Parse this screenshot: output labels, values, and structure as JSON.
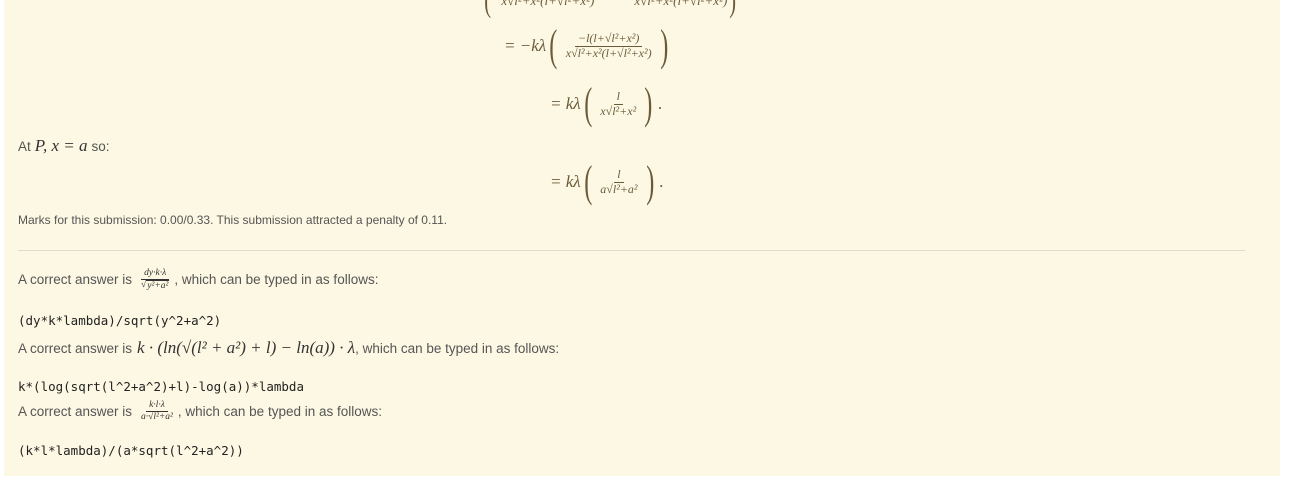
{
  "feedback": {
    "at_p_label": "At",
    "at_p_math": "P, x = a",
    "at_p_suffix": "so:",
    "marks_text": "Marks for this submission: 0.00/0.33. This submission attracted a penalty of 0.11."
  },
  "derivation": {
    "line1_eq": "= −kλ",
    "line1_num": "−l(l+√l²+x²)",
    "line1_den": "x√l²+x²(l+√l²+x²)",
    "line2_eq": "= kλ",
    "line2_num": "l",
    "line2_den": "x√l²+x²",
    "line3_eq": "= kλ",
    "line3_num": "l",
    "line3_den": "a√l²+a²",
    "period": "."
  },
  "answers": [
    {
      "prefix": "A correct answer is",
      "num": "dy·k·λ",
      "den": "y²+a²",
      "suffix": ", which can be typed in as follows:",
      "code": "(dy*k*lambda)/sqrt(y^2+a^2)"
    },
    {
      "prefix": "A correct answer is",
      "math": "k · (ln(√(l² + a²) + l) − ln(a)) · λ",
      "suffix": ", which can be typed in as follows:",
      "code": "k*(log(sqrt(l^2+a^2)+l)-log(a))*lambda"
    },
    {
      "prefix": "A correct answer is",
      "num": "k·l·λ",
      "den": "a·√l²+a²",
      "suffix": ", which can be typed in as follows:",
      "code": "(k*l*lambda)/(a*sqrt(l^2+a^2))"
    }
  ]
}
